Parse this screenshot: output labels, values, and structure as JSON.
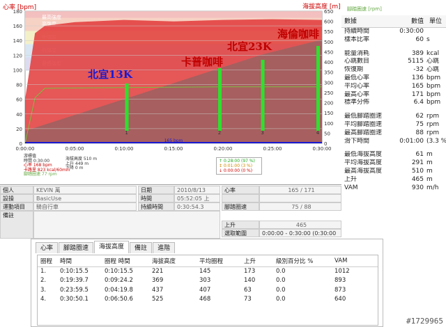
{
  "chart": {
    "title_left": "心率 [bpm]",
    "title_right": "海拔高度 [m]",
    "title_right2": "腳踏圈速 [rpm]",
    "y_left_ticks": [
      "180",
      "160",
      "140",
      "120",
      "100",
      "80",
      "60",
      "40",
      "20",
      "0"
    ],
    "y_right_ticks": [
      "650",
      "600",
      "550",
      "500",
      "450",
      "400",
      "350",
      "300",
      "250",
      "200",
      "150",
      "100",
      "50",
      "0"
    ],
    "x_ticks": [
      "0:00:00",
      "0:05:00",
      "0:10:00",
      "0:15:00",
      "0:20:00",
      "0:25:00",
      "0:30:00"
    ],
    "zones": [
      "最高強度",
      "高強度",
      "中強度",
      "低強度",
      "最低強度"
    ],
    "annotations": [
      {
        "text": "北宜13K",
        "color": "#1a1ad0"
      },
      {
        "text": "卡普咖啡",
        "color": "#c00000"
      },
      {
        "text": "北宜23K",
        "color": "#c00000"
      },
      {
        "text": "海倫咖啡",
        "color": "#c00000"
      }
    ],
    "lap_markers": [
      "1",
      "2",
      "3",
      "4"
    ],
    "bottom_label": "165 bpm",
    "stats_box": {
      "title": "游標值",
      "lines": [
        "時間 0:30:00",
        "心率 168 bpm",
        "卡路里 823 kcal/60min",
        "腳踏圈速 77 rpm"
      ],
      "alt_lines": [
        "海拔高度 510 m",
        "上升 449 m",
        "下降 0 m"
      ]
    },
    "zone_box": [
      "↑ 0:28:00 (97 %)",
      "↕ 0:01:00 (3 %)",
      "↓ 0:00:00 (0 %)"
    ],
    "colors": {
      "hr_area": "#e23a3a",
      "altitude": "#a06060",
      "cadence": "#7bbf3f",
      "lap": "#2ee02e"
    }
  },
  "chart_data": {
    "type": "line",
    "x_unit": "time",
    "series": [
      {
        "name": "心率",
        "unit": "bpm",
        "x": [
          "0:00:00",
          "0:01:00",
          "0:02:00",
          "0:05:00",
          "0:10:00",
          "0:15:00",
          "0:20:00",
          "0:25:00",
          "0:30:00"
        ],
        "values": [
          60,
          150,
          160,
          165,
          168,
          166,
          168,
          169,
          168
        ]
      },
      {
        "name": "海拔高度",
        "unit": "m",
        "x": [
          "0:00:00",
          "0:10:15",
          "0:19:39",
          "0:23:59",
          "0:30:00"
        ],
        "values": [
          61,
          221,
          369,
          437,
          510
        ]
      },
      {
        "name": "腳踏圈速",
        "unit": "rpm",
        "x": [
          "0:00:00",
          "0:01:00",
          "0:02:00",
          "0:10:00",
          "0:20:00",
          "0:30:00"
        ],
        "values": [
          0,
          62,
          75,
          76,
          77,
          77
        ]
      }
    ],
    "ylim_left": [
      0,
      180
    ],
    "ylim_right": [
      0,
      650
    ]
  },
  "summary": {
    "headers": [
      "數據",
      "數值",
      "單位"
    ],
    "rows": [
      {
        "label": "持續時間",
        "value": "0:30:00",
        "unit": ""
      },
      {
        "label": "樣本比率",
        "value": "60",
        "unit": "s"
      },
      {
        "gap": true
      },
      {
        "label": "能量消耗",
        "value": "389",
        "unit": "kcal"
      },
      {
        "label": "心跳數目",
        "value": "5115",
        "unit": "心跳"
      },
      {
        "label": "恢復期",
        "value": "-32",
        "unit": "心跳"
      },
      {
        "label": "最低心率",
        "value": "136",
        "unit": "bpm"
      },
      {
        "label": "平均心率",
        "value": "165",
        "unit": "bpm"
      },
      {
        "label": "最高心率",
        "value": "171",
        "unit": "bpm"
      },
      {
        "label": "標準分佈",
        "value": "6.4",
        "unit": "bpm"
      },
      {
        "gap": true
      },
      {
        "label": "最低腳踏圈速",
        "value": "62",
        "unit": "rpm"
      },
      {
        "label": "平均腳踏圈速",
        "value": "75",
        "unit": "rpm"
      },
      {
        "label": "最高腳踏圈速",
        "value": "88",
        "unit": "rpm"
      },
      {
        "label": "滑下時間",
        "value": "0:01:00",
        "unit": "(3.3 %"
      },
      {
        "gap": true
      },
      {
        "label": "最低海拔高度",
        "value": "61",
        "unit": "m"
      },
      {
        "label": "平均海拔高度",
        "value": "291",
        "unit": "m"
      },
      {
        "label": "最高海拔高度",
        "value": "510",
        "unit": "m"
      },
      {
        "label": "上升",
        "value": "465",
        "unit": "m"
      },
      {
        "label": "VAM",
        "value": "930",
        "unit": "m/h"
      }
    ]
  },
  "info": {
    "person_label": "個人",
    "person_value": "KEVIN 萬",
    "mode_label": "設操",
    "mode_value": "BasicUse",
    "sport_label": "運動項目",
    "sport_value": "騎自行車",
    "note_label": "備註",
    "note_value": "",
    "date_label": "日期",
    "date_value": "2010/8/13",
    "time_label": "時間",
    "time_value": "05:52:05 上",
    "dur_label": "持續時間",
    "dur_value": "0:30:54.3",
    "hr_label": "心率",
    "hr_value": "165 / 171",
    "cad_label": "腳踏圈速",
    "cad_value": "75 / 88",
    "ascent_label": "上升",
    "ascent_value": "465",
    "range_label": "選取範圍",
    "range_value": "0:00:00 - 0:30:00 (0:30:00"
  },
  "tabs": [
    "心率",
    "腳踏圈速",
    "海拔高度",
    "備註",
    "進階"
  ],
  "table": {
    "headers": [
      "圈程",
      "時間",
      "圈程 時間",
      "海拔高度",
      "平均圈程",
      "上升",
      "級別百分比 %",
      "VAM"
    ],
    "rows": [
      [
        "1.",
        "0:10:15.5",
        "0:10:15.5",
        "221",
        "145",
        "173",
        "0.0",
        "1012"
      ],
      [
        "2.",
        "0:19:39.7",
        "0:09:24.2",
        "369",
        "303",
        "140",
        "0.0",
        "893"
      ],
      [
        "3.",
        "0:23:59.5",
        "0:04:19.8",
        "437",
        "407",
        "63",
        "0.0",
        "873"
      ],
      [
        "4.",
        "0:30:50.1",
        "0:06:50.6",
        "525",
        "468",
        "73",
        "0.0",
        "640"
      ]
    ]
  },
  "watermark": "#1729965"
}
